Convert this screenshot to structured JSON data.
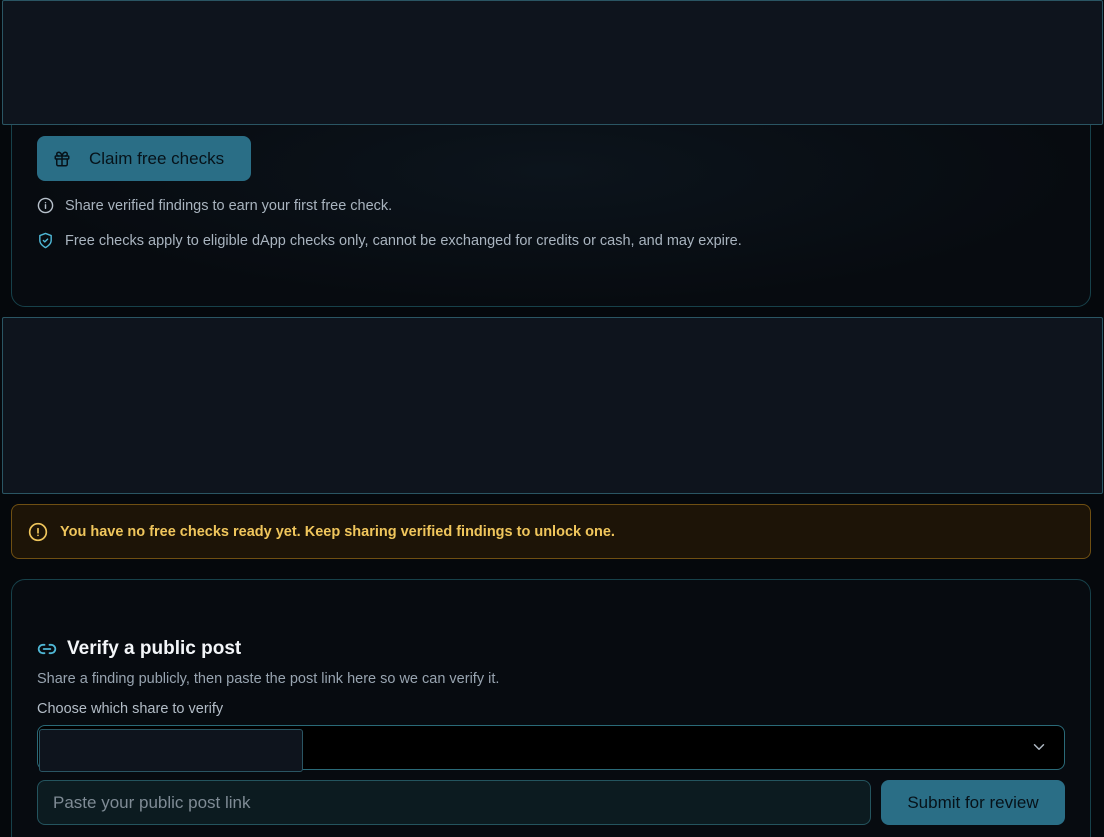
{
  "claim": {
    "button_label": "Claim free checks",
    "info_text": "Share verified findings to earn your first free check.",
    "terms_text": "Free checks apply to eligible dApp checks only, cannot be exchanged for credits or cash, and may expire."
  },
  "warning": {
    "text": "You have no free checks ready yet. Keep sharing verified findings to unlock one."
  },
  "verify": {
    "title": "Verify a public post",
    "description": "Share a finding publicly, then paste the post link here so we can verify it.",
    "select_label": "Choose which share to verify",
    "input_placeholder": "Paste your public post link",
    "submit_label": "Submit for review"
  },
  "colors": {
    "accent": "#2a6e86",
    "warning_text": "#f0c65c",
    "warning_border": "#6f4f12",
    "card_border": "#17414a"
  },
  "icons": [
    "gift-icon",
    "info-icon",
    "shield-check-icon",
    "warning-circle-icon",
    "link-icon",
    "chevron-down-icon"
  ]
}
